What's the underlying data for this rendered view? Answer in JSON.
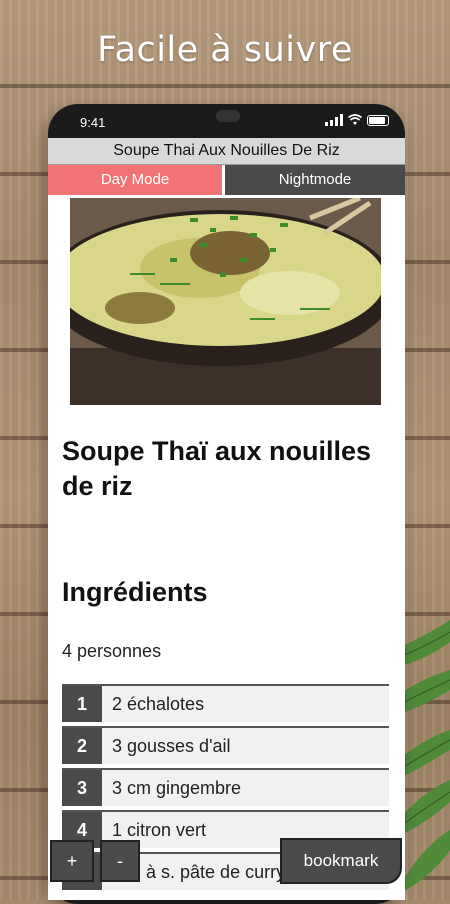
{
  "promo": {
    "headline": "Facile à suivre"
  },
  "status_bar": {
    "time": "9:41"
  },
  "app": {
    "title": "Soupe Thai Aux Nouilles De Riz",
    "mode_tabs": {
      "day": "Day Mode",
      "night": "Nightmode"
    }
  },
  "recipe": {
    "name": "Soupe Thaï aux nouilles de riz",
    "ingredients_heading": "Ingrédients",
    "servings": "4 personnes",
    "ingredients": [
      {
        "n": "1",
        "text": "2 échalotes"
      },
      {
        "n": "2",
        "text": "3 gousses d'ail"
      },
      {
        "n": "3",
        "text": "3 cm gingembre"
      },
      {
        "n": "4",
        "text": "1 citron vert"
      },
      {
        "n": "5",
        "text": "2 c. à s. pâte de curry"
      }
    ]
  },
  "controls": {
    "plus": "+",
    "minus": "-",
    "bookmark": "bookmark"
  },
  "colors": {
    "day_mode": "#f27373",
    "dark_gray": "#4a4a4a"
  }
}
